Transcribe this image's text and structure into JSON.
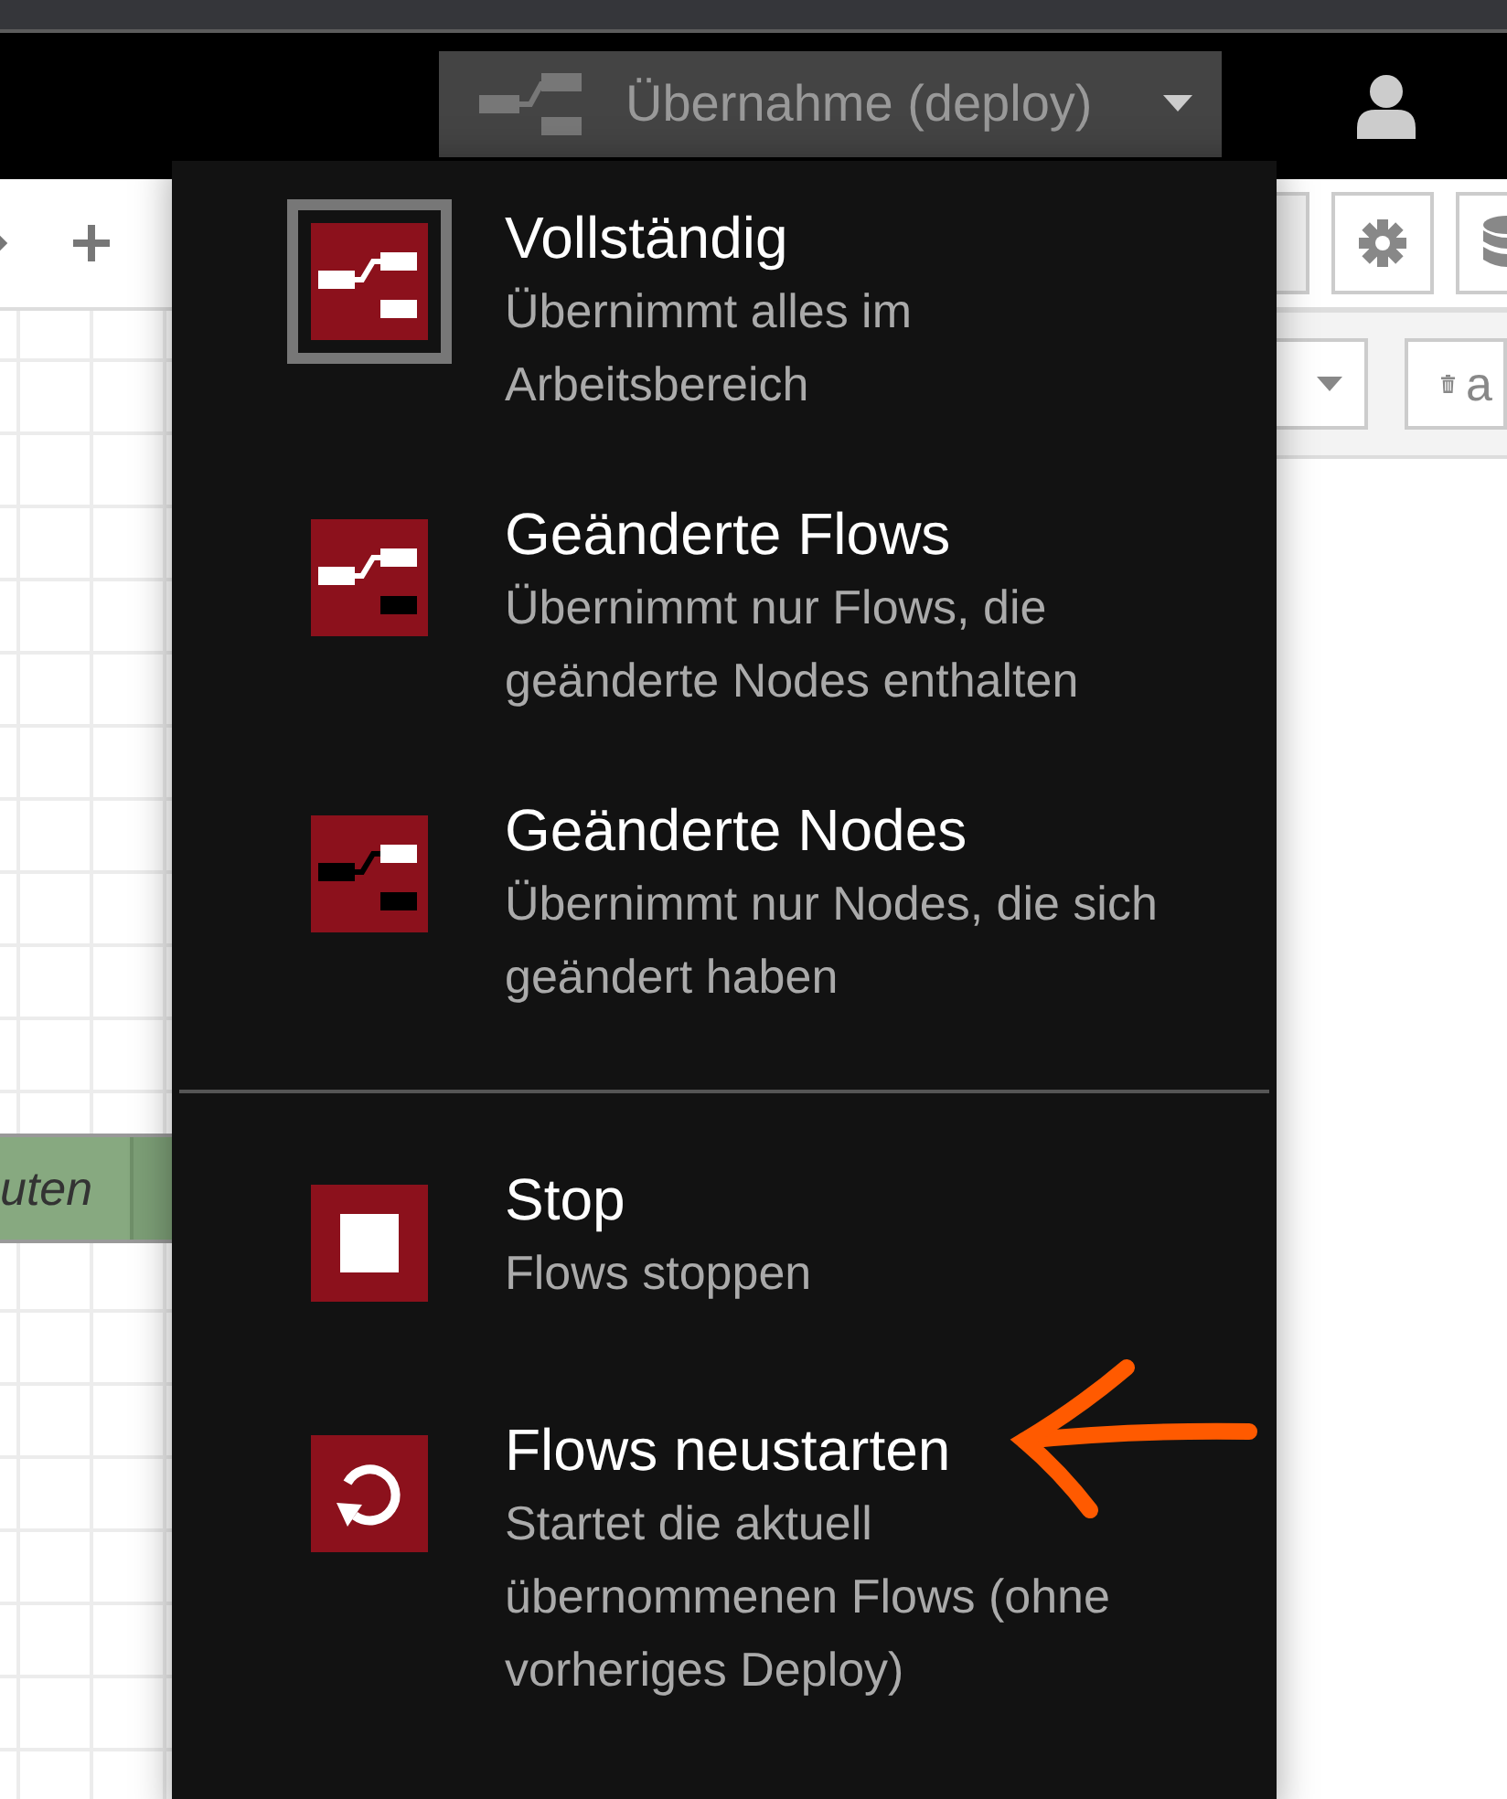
{
  "header": {
    "deploy_button": {
      "label": "Übernahme (deploy)"
    }
  },
  "workspace": {
    "node": {
      "label": "uten"
    }
  },
  "sidebar": {
    "clear_button": {
      "label": "a"
    }
  },
  "deploy_menu": {
    "sections": [
      {
        "items": [
          {
            "kind": "full",
            "title": "Vollständig",
            "description": "Übernimmt alles im Arbeitsbereich",
            "selected": true
          },
          {
            "kind": "flows",
            "title": "Geänderte Flows",
            "description": "Übernimmt nur Flows, die geänderte Nodes enthalten",
            "selected": false
          },
          {
            "kind": "nodes",
            "title": "Geänderte Nodes",
            "description": "Übernimmt nur Nodes, die sich geändert haben",
            "selected": false
          }
        ]
      },
      {
        "items": [
          {
            "kind": "stop",
            "title": "Stop",
            "description": "Flows stoppen",
            "selected": false
          },
          {
            "kind": "restart",
            "title": "Flows neustarten",
            "description": "Startet die aktuell übernommenen Flows (ohne vorheriges Deploy)",
            "selected": false
          }
        ]
      }
    ]
  }
}
